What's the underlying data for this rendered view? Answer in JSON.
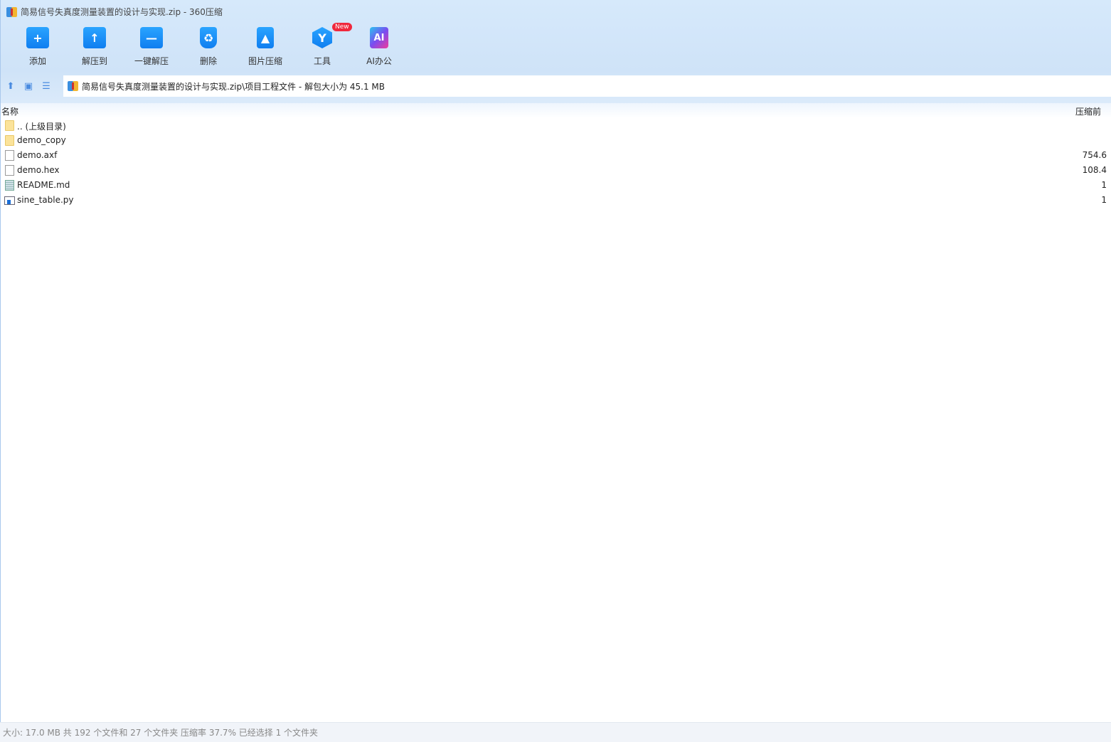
{
  "window": {
    "title": "简易信号失真度测量装置的设计与实现.zip - 360压缩"
  },
  "toolbar": {
    "items": [
      {
        "label": "添加",
        "icon": "folder-add-icon",
        "glyph": "+"
      },
      {
        "label": "解压到",
        "icon": "folder-extract-icon",
        "glyph": "↑"
      },
      {
        "label": "一键解压",
        "icon": "folder-oneclick-icon",
        "glyph": "—"
      },
      {
        "label": "删除",
        "icon": "trash-icon",
        "glyph": "♻"
      },
      {
        "label": "图片压缩",
        "icon": "image-compress-icon",
        "glyph": "▲"
      },
      {
        "label": "工具",
        "icon": "tools-icon",
        "glyph": "Y",
        "badge": "New"
      },
      {
        "label": "AI办公",
        "icon": "ai-office-icon",
        "glyph": "AI"
      }
    ]
  },
  "address": {
    "path": "简易信号失真度测量装置的设计与实现.zip\\项目工程文件 - 解包大小为 45.1 MB"
  },
  "list": {
    "columns": {
      "name": "名称",
      "size": "压缩前"
    },
    "rows": [
      {
        "name": ".. (上级目录)",
        "type": "folder",
        "size": ""
      },
      {
        "name": "demo_copy",
        "type": "folder",
        "size": ""
      },
      {
        "name": "demo.axf",
        "type": "file",
        "size": "754.6"
      },
      {
        "name": "demo.hex",
        "type": "file",
        "size": "108.4"
      },
      {
        "name": "README.md",
        "type": "md",
        "size": "1"
      },
      {
        "name": "sine_table.py",
        "type": "py",
        "size": "1"
      }
    ]
  },
  "status": {
    "text": "大小: 17.0 MB 共 192 个文件和 27 个文件夹 压缩率 37.7% 已经选择 1 个文件夹"
  }
}
